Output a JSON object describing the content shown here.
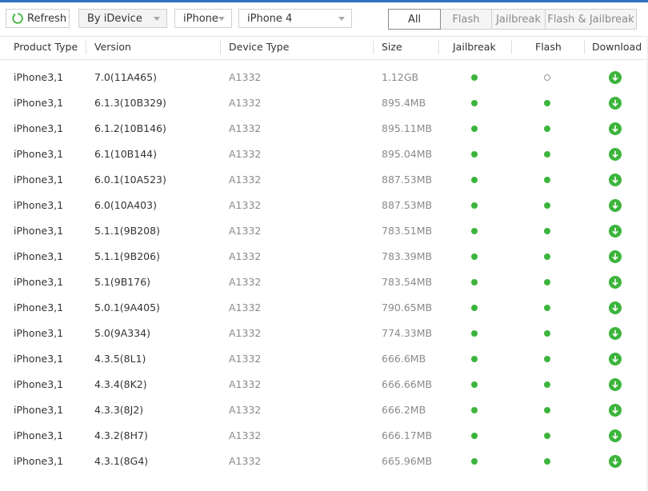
{
  "toolbar": {
    "refresh_label": "Refresh",
    "mode_select": "By iDevice",
    "device_type_select": "iPhone",
    "model_select": "iPhone 4",
    "filters": [
      "All",
      "Flash",
      "Jailbreak",
      "Flash & Jailbreak"
    ],
    "active_filter": "All"
  },
  "columns": [
    "Product Type",
    "Version",
    "Device Type",
    "Size",
    "Jailbreak",
    "Flash",
    "Download"
  ],
  "colors": {
    "accent_green": "#3cb43c",
    "top_bar": "#2f6fc2"
  },
  "rows": [
    {
      "product": "iPhone3,1",
      "version": "7.0(11A465)",
      "device": "A1332",
      "size": "1.12GB",
      "jailbreak": true,
      "flash": false
    },
    {
      "product": "iPhone3,1",
      "version": "6.1.3(10B329)",
      "device": "A1332",
      "size": "895.4MB",
      "jailbreak": true,
      "flash": true
    },
    {
      "product": "iPhone3,1",
      "version": "6.1.2(10B146)",
      "device": "A1332",
      "size": "895.11MB",
      "jailbreak": true,
      "flash": true
    },
    {
      "product": "iPhone3,1",
      "version": "6.1(10B144)",
      "device": "A1332",
      "size": "895.04MB",
      "jailbreak": true,
      "flash": true
    },
    {
      "product": "iPhone3,1",
      "version": "6.0.1(10A523)",
      "device": "A1332",
      "size": "887.53MB",
      "jailbreak": true,
      "flash": true
    },
    {
      "product": "iPhone3,1",
      "version": "6.0(10A403)",
      "device": "A1332",
      "size": "887.53MB",
      "jailbreak": true,
      "flash": true
    },
    {
      "product": "iPhone3,1",
      "version": "5.1.1(9B208)",
      "device": "A1332",
      "size": "783.51MB",
      "jailbreak": true,
      "flash": true
    },
    {
      "product": "iPhone3,1",
      "version": "5.1.1(9B206)",
      "device": "A1332",
      "size": "783.39MB",
      "jailbreak": true,
      "flash": true
    },
    {
      "product": "iPhone3,1",
      "version": "5.1(9B176)",
      "device": "A1332",
      "size": "783.54MB",
      "jailbreak": true,
      "flash": true
    },
    {
      "product": "iPhone3,1",
      "version": "5.0.1(9A405)",
      "device": "A1332",
      "size": "790.65MB",
      "jailbreak": true,
      "flash": true
    },
    {
      "product": "iPhone3,1",
      "version": "5.0(9A334)",
      "device": "A1332",
      "size": "774.33MB",
      "jailbreak": true,
      "flash": true
    },
    {
      "product": "iPhone3,1",
      "version": "4.3.5(8L1)",
      "device": "A1332",
      "size": "666.6MB",
      "jailbreak": true,
      "flash": true
    },
    {
      "product": "iPhone3,1",
      "version": "4.3.4(8K2)",
      "device": "A1332",
      "size": "666.66MB",
      "jailbreak": true,
      "flash": true
    },
    {
      "product": "iPhone3,1",
      "version": "4.3.3(8J2)",
      "device": "A1332",
      "size": "666.2MB",
      "jailbreak": true,
      "flash": true
    },
    {
      "product": "iPhone3,1",
      "version": "4.3.2(8H7)",
      "device": "A1332",
      "size": "666.17MB",
      "jailbreak": true,
      "flash": true
    },
    {
      "product": "iPhone3,1",
      "version": "4.3.1(8G4)",
      "device": "A1332",
      "size": "665.96MB",
      "jailbreak": true,
      "flash": true
    }
  ]
}
